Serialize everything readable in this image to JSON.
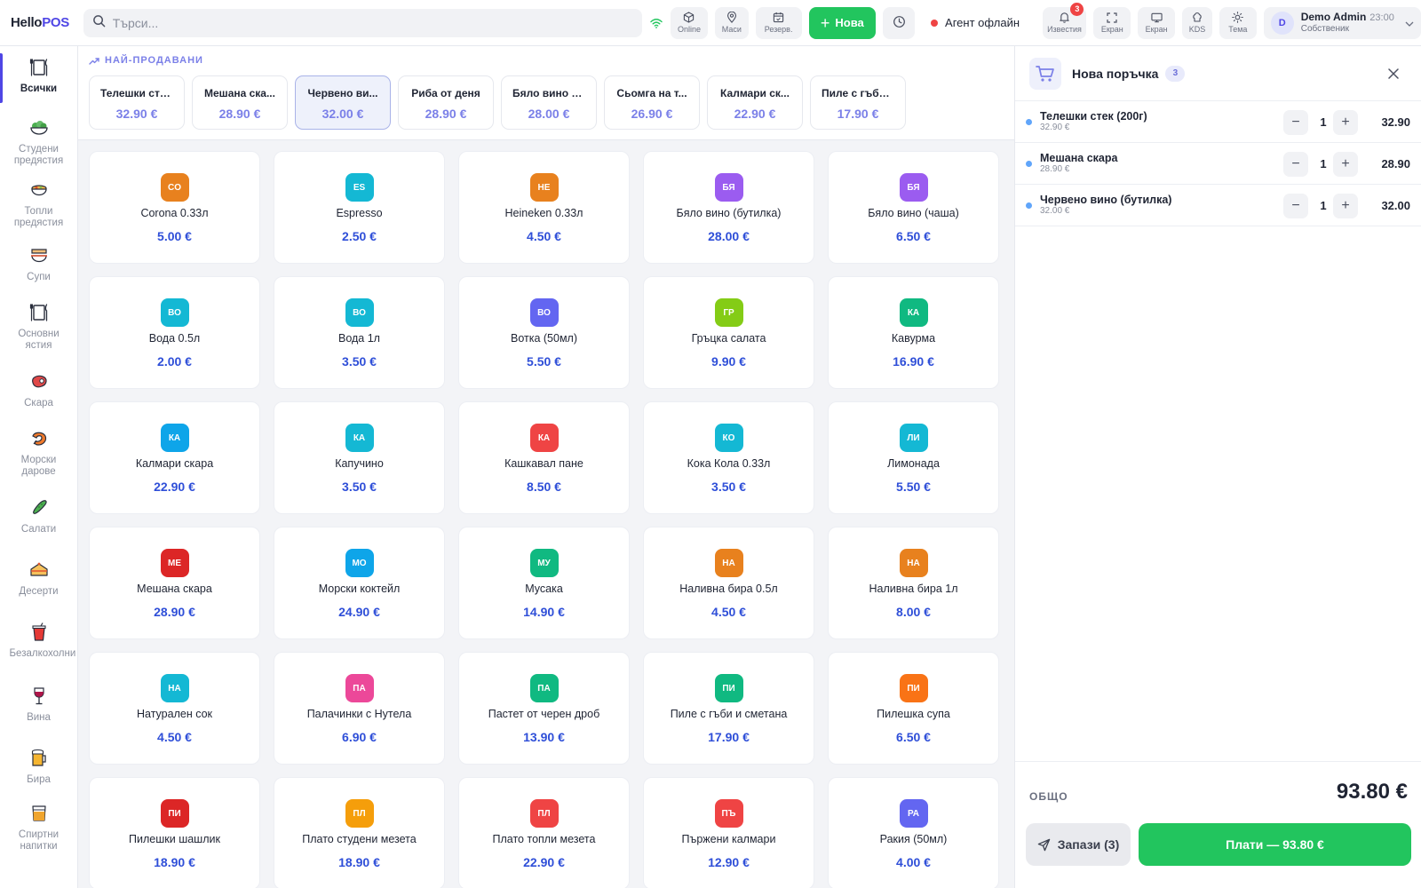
{
  "app": {
    "logo_a": "Hello",
    "logo_b": "POS"
  },
  "search": {
    "placeholder": "Търси..."
  },
  "toolbar": {
    "online": "Online",
    "tables": "Маси",
    "reservations": "Резерв.",
    "new_label": "Нова",
    "agent_status": "Агент офлайн",
    "notifications": "Известия",
    "notifications_count": "3",
    "screen": "Екран",
    "display": "Екран",
    "kds": "KDS",
    "theme": "Тема"
  },
  "user": {
    "name": "Demo Admin",
    "time": "23:00",
    "role": "Собственик",
    "initial": "D"
  },
  "sidebar": {
    "items": [
      {
        "label": "Всички",
        "icon": "cutlery-icon"
      },
      {
        "label": "Студени предястия",
        "icon": "salad-bowl-icon"
      },
      {
        "label": "Топли предястия",
        "icon": "hot-bowl-icon"
      },
      {
        "label": "Супи",
        "icon": "soup-icon"
      },
      {
        "label": "Основни ястия",
        "icon": "cutlery-icon"
      },
      {
        "label": "Скара",
        "icon": "meat-icon"
      },
      {
        "label": "Морски дарове",
        "icon": "shrimp-icon"
      },
      {
        "label": "Салати",
        "icon": "cucumber-icon"
      },
      {
        "label": "Десерти",
        "icon": "cake-icon"
      },
      {
        "label": "Безалкохолни",
        "icon": "soft-drink-icon"
      },
      {
        "label": "Вина",
        "icon": "wine-glass-icon"
      },
      {
        "label": "Бира",
        "icon": "beer-icon"
      },
      {
        "label": "Спиртни напитки",
        "icon": "tumbler-icon"
      }
    ]
  },
  "bestsellers": {
    "title": "НАЙ-ПРОДАВАНИ",
    "items": [
      {
        "name": "Телешки сте...",
        "price": "32.90 €"
      },
      {
        "name": "Мешана ска...",
        "price": "28.90 €"
      },
      {
        "name": "Червено ви...",
        "price": "32.00 €"
      },
      {
        "name": "Риба от деня",
        "price": "28.90 €"
      },
      {
        "name": "Бяло вино (б...",
        "price": "28.00 €"
      },
      {
        "name": "Сьомга на т...",
        "price": "26.90 €"
      },
      {
        "name": "Калмари ск...",
        "price": "22.90 €"
      },
      {
        "name": "Пиле с гъби ...",
        "price": "17.90 €"
      }
    ]
  },
  "products": [
    {
      "abbr": "CO",
      "name": "Corona 0.33л",
      "price": "5.00 €",
      "color": "#e8811e"
    },
    {
      "abbr": "ES",
      "name": "Espresso",
      "price": "2.50 €",
      "color": "#14b8d4"
    },
    {
      "abbr": "HE",
      "name": "Heineken 0.33л",
      "price": "4.50 €",
      "color": "#e8811e"
    },
    {
      "abbr": "БЯ",
      "name": "Бяло вино (бутилка)",
      "price": "28.00 €",
      "color": "#9b5cf0"
    },
    {
      "abbr": "БЯ",
      "name": "Бяло вино (чаша)",
      "price": "6.50 €",
      "color": "#9b5cf0"
    },
    {
      "abbr": "ВО",
      "name": "Вода 0.5л",
      "price": "2.00 €",
      "color": "#14b8d4"
    },
    {
      "abbr": "ВО",
      "name": "Вода 1л",
      "price": "3.50 €",
      "color": "#14b8d4"
    },
    {
      "abbr": "ВО",
      "name": "Вотка (50мл)",
      "price": "5.50 €",
      "color": "#6366f1"
    },
    {
      "abbr": "ГР",
      "name": "Гръцка салата",
      "price": "9.90 €",
      "color": "#84cc16"
    },
    {
      "abbr": "КА",
      "name": "Кавурма",
      "price": "16.90 €",
      "color": "#10b981"
    },
    {
      "abbr": "КА",
      "name": "Калмари скара",
      "price": "22.90 €",
      "color": "#0ea5e9"
    },
    {
      "abbr": "КА",
      "name": "Капучино",
      "price": "3.50 €",
      "color": "#14b8d4"
    },
    {
      "abbr": "КА",
      "name": "Кашкавал пане",
      "price": "8.50 €",
      "color": "#ef4444"
    },
    {
      "abbr": "КО",
      "name": "Кока Кола 0.33л",
      "price": "3.50 €",
      "color": "#14b8d4"
    },
    {
      "abbr": "ЛИ",
      "name": "Лимонада",
      "price": "5.50 €",
      "color": "#14b8d4"
    },
    {
      "abbr": "МЕ",
      "name": "Мешана скара",
      "price": "28.90 €",
      "color": "#dc2626"
    },
    {
      "abbr": "МО",
      "name": "Морски коктейл",
      "price": "24.90 €",
      "color": "#0ea5e9"
    },
    {
      "abbr": "МУ",
      "name": "Мусака",
      "price": "14.90 €",
      "color": "#10b981"
    },
    {
      "abbr": "НА",
      "name": "Наливна бира 0.5л",
      "price": "4.50 €",
      "color": "#e8811e"
    },
    {
      "abbr": "НА",
      "name": "Наливна бира 1л",
      "price": "8.00 €",
      "color": "#e8811e"
    },
    {
      "abbr": "НА",
      "name": "Натурален сок",
      "price": "4.50 €",
      "color": "#14b8d4"
    },
    {
      "abbr": "ПА",
      "name": "Палачинки с Нутела",
      "price": "6.90 €",
      "color": "#ec4899"
    },
    {
      "abbr": "ПА",
      "name": "Пастет от черен дроб",
      "price": "13.90 €",
      "color": "#10b981"
    },
    {
      "abbr": "ПИ",
      "name": "Пиле с гъби и сметана",
      "price": "17.90 €",
      "color": "#10b981"
    },
    {
      "abbr": "ПИ",
      "name": "Пилешка супа",
      "price": "6.50 €",
      "color": "#f97316"
    },
    {
      "abbr": "ПИ",
      "name": "Пилешки шашлик",
      "price": "18.90 €",
      "color": "#dc2626"
    },
    {
      "abbr": "ПЛ",
      "name": "Плато студени мезета",
      "price": "18.90 €",
      "color": "#f59e0b"
    },
    {
      "abbr": "ПЛ",
      "name": "Плато топли мезета",
      "price": "22.90 €",
      "color": "#ef4444"
    },
    {
      "abbr": "ПЪ",
      "name": "Пържени калмари",
      "price": "12.90 €",
      "color": "#ef4444"
    },
    {
      "abbr": "РА",
      "name": "Ракия (50мл)",
      "price": "4.00 €",
      "color": "#6366f1"
    }
  ],
  "order": {
    "title": "Нова поръчка",
    "count": "3",
    "items": [
      {
        "name": "Телешки стек (200г)",
        "unit_price": "32.90 €",
        "qty": "1",
        "total": "32.90"
      },
      {
        "name": "Мешана скара",
        "unit_price": "28.90 €",
        "qty": "1",
        "total": "28.90"
      },
      {
        "name": "Червено вино (бутилка)",
        "unit_price": "32.00 €",
        "qty": "1",
        "total": "32.00"
      }
    ],
    "total_label": "ОБЩО",
    "total": "93.80 €",
    "save_label": "Запази (3)",
    "pay_label": "Плати — 93.80 €"
  }
}
